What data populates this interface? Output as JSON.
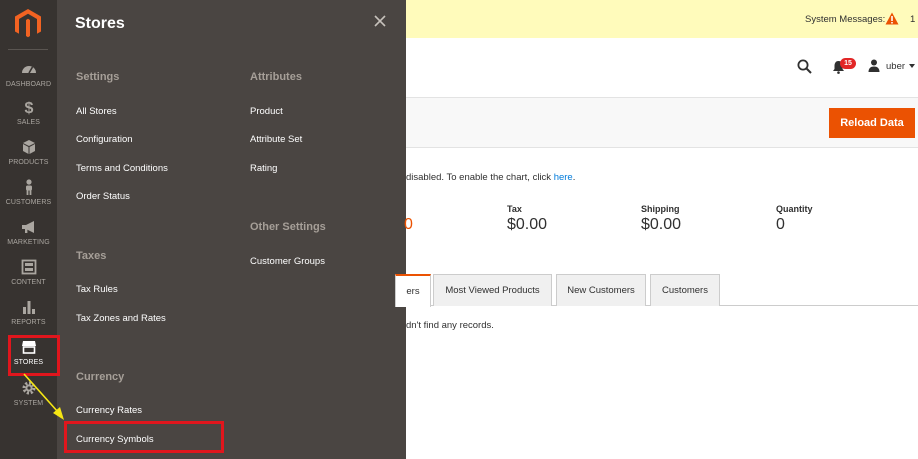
{
  "sidebar": {
    "items": [
      {
        "label": "DASHBOARD",
        "icon": "dashboard-icon"
      },
      {
        "label": "SALES",
        "icon": "dollar-icon"
      },
      {
        "label": "PRODUCTS",
        "icon": "cube-icon"
      },
      {
        "label": "CUSTOMERS",
        "icon": "person-icon"
      },
      {
        "label": "MARKETING",
        "icon": "megaphone-icon"
      },
      {
        "label": "CONTENT",
        "icon": "layout-icon"
      },
      {
        "label": "REPORTS",
        "icon": "bar-chart-icon"
      },
      {
        "label": "STORES",
        "icon": "storefront-icon"
      },
      {
        "label": "SYSTEM",
        "icon": "gear-icon"
      }
    ],
    "active": "STORES"
  },
  "flyout": {
    "title": "Stores",
    "settings": {
      "title": "Settings",
      "links": [
        "All Stores",
        "Configuration",
        "Terms and Conditions",
        "Order Status"
      ]
    },
    "taxes": {
      "title": "Taxes",
      "links": [
        "Tax Rules",
        "Tax Zones and Rates"
      ]
    },
    "currency": {
      "title": "Currency",
      "links": [
        "Currency Rates",
        "Currency Symbols"
      ]
    },
    "attributes": {
      "title": "Attributes",
      "links": [
        "Product",
        "Attribute Set",
        "Rating"
      ]
    },
    "other": {
      "title": "Other Settings",
      "links": [
        "Customer Groups"
      ]
    }
  },
  "system_bar": {
    "label": "System Messages:",
    "count": "1"
  },
  "header": {
    "notifications": "15",
    "user": "uber"
  },
  "actions": {
    "reload": "Reload Data"
  },
  "chart_note": {
    "text": "disabled. To enable the chart, click",
    "link": "here",
    "suffix": "."
  },
  "totals": {
    "revenue_fragment": "0",
    "items": [
      {
        "label": "Tax",
        "value": "$0.00"
      },
      {
        "label": "Shipping",
        "value": "$0.00"
      },
      {
        "label": "Quantity",
        "value": "0"
      }
    ]
  },
  "tabs": [
    {
      "label": "ers"
    },
    {
      "label": "Most Viewed Products"
    },
    {
      "label": "New Customers"
    },
    {
      "label": "Customers"
    }
  ],
  "grid": {
    "empty": "dn't find any records."
  },
  "colors": {
    "accent": "#eb5202",
    "highlight": "#e0161d",
    "sidebar": "#373330",
    "flyout": "#4a4542"
  }
}
